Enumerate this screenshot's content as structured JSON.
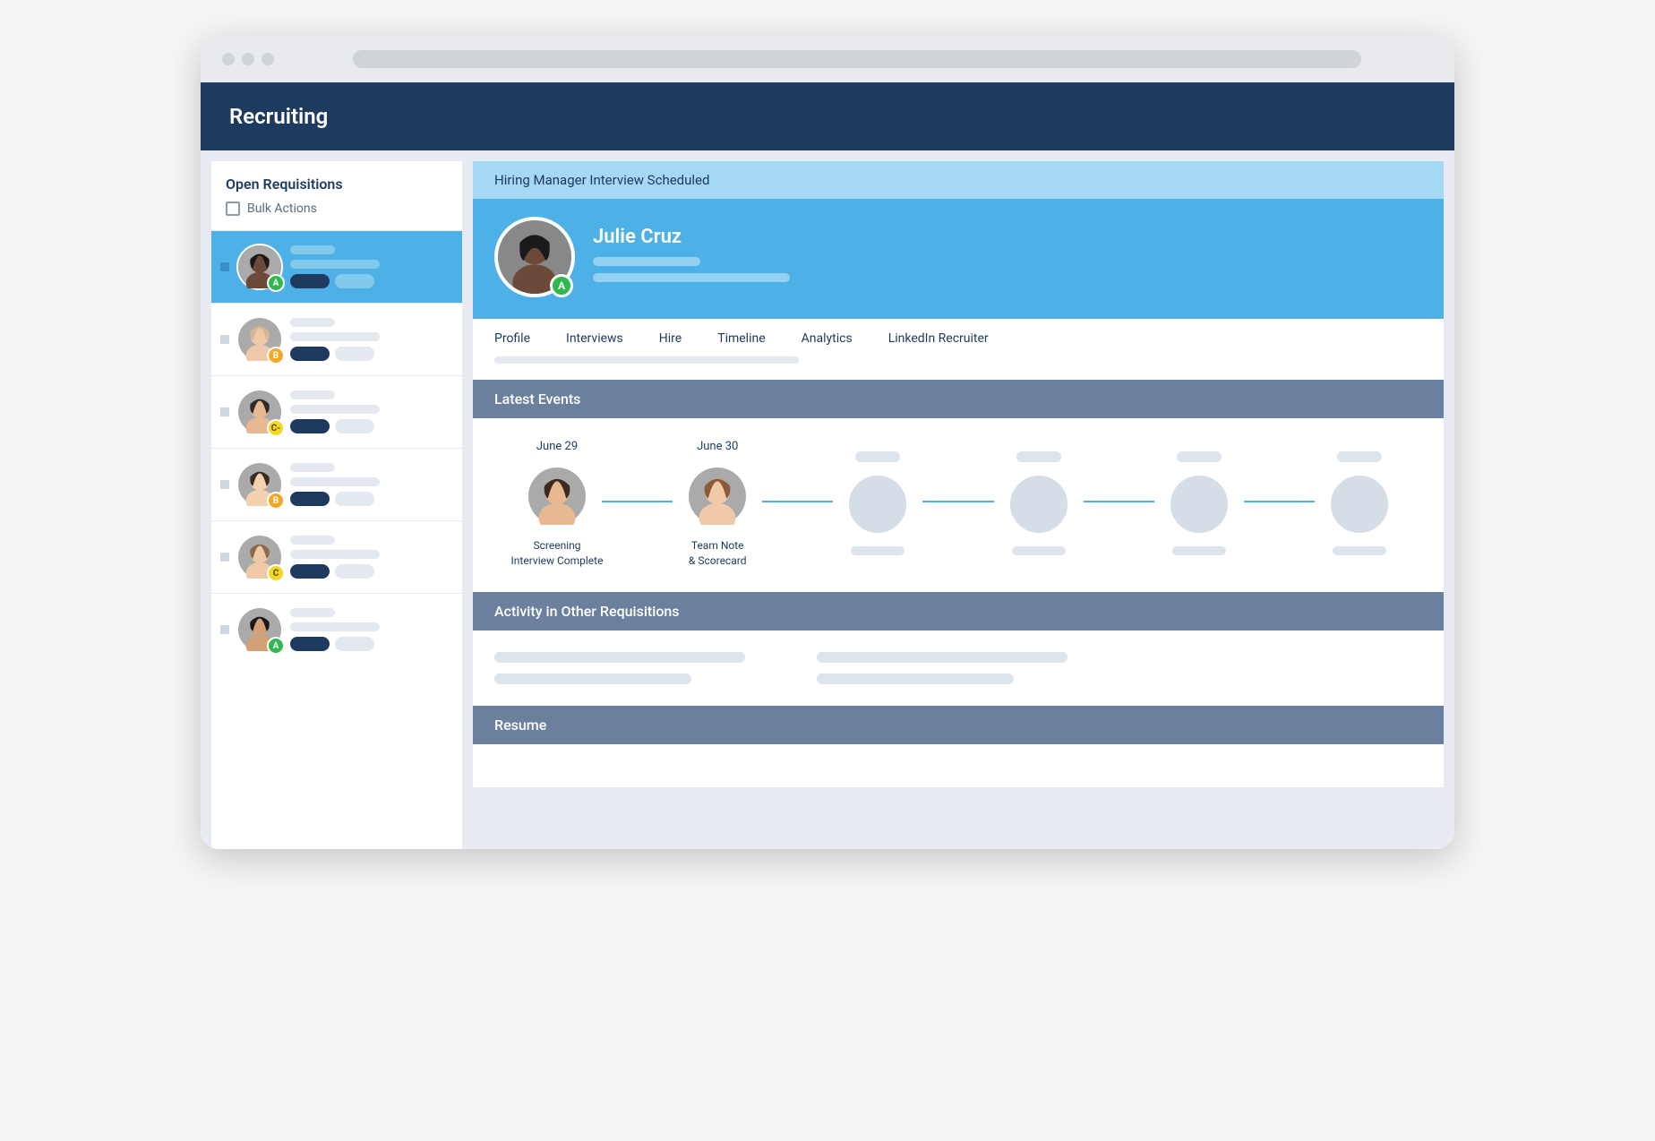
{
  "header": {
    "title": "Recruiting"
  },
  "sidebar": {
    "title": "Open Requisitions",
    "bulk_label": "Bulk Actions",
    "candidates": [
      {
        "grade": "A",
        "grade_class": "grade-A",
        "active": true,
        "skin": "#6b4a3a",
        "hair": "#1a1a1a"
      },
      {
        "grade": "B",
        "grade_class": "grade-B",
        "active": false,
        "skin": "#f0c9a8",
        "hair": "#d4b896"
      },
      {
        "grade": "C-",
        "grade_class": "grade-C",
        "active": false,
        "skin": "#e8b890",
        "hair": "#2a2a2a"
      },
      {
        "grade": "B",
        "grade_class": "grade-B",
        "active": false,
        "skin": "#f2d0b0",
        "hair": "#3a2a20"
      },
      {
        "grade": "C",
        "grade_class": "grade-C",
        "active": false,
        "skin": "#f0c9a8",
        "hair": "#8a6a4a"
      },
      {
        "grade": "A",
        "grade_class": "grade-A",
        "active": false,
        "skin": "#d4a078",
        "hair": "#1a1a1a"
      }
    ]
  },
  "main": {
    "status": "Hiring Manager Interview Scheduled",
    "candidate_name": "Julie Cruz",
    "candidate_grade": "A",
    "tabs": [
      "Profile",
      "Interviews",
      "Hire",
      "Timeline",
      "Analytics",
      "LinkedIn Recruiter"
    ],
    "sections": {
      "latest_events": "Latest Events",
      "other_activity": "Activity in Other Requisitions",
      "resume": "Resume"
    },
    "timeline": [
      {
        "date": "June 29",
        "label_l1": "Screening",
        "label_l2": "Interview Complete",
        "has_avatar": true,
        "skin": "#e8b890",
        "hair": "#3a2a20"
      },
      {
        "date": "June 30",
        "label_l1": "Team Note",
        "label_l2": "& Scorecard",
        "has_avatar": true,
        "skin": "#f0c9a8",
        "hair": "#8a5a3a"
      },
      {
        "date": "",
        "label_l1": "",
        "label_l2": "",
        "has_avatar": false
      },
      {
        "date": "",
        "label_l1": "",
        "label_l2": "",
        "has_avatar": false
      },
      {
        "date": "",
        "label_l1": "",
        "label_l2": "",
        "has_avatar": false
      },
      {
        "date": "",
        "label_l1": "",
        "label_l2": "",
        "has_avatar": false
      }
    ]
  }
}
